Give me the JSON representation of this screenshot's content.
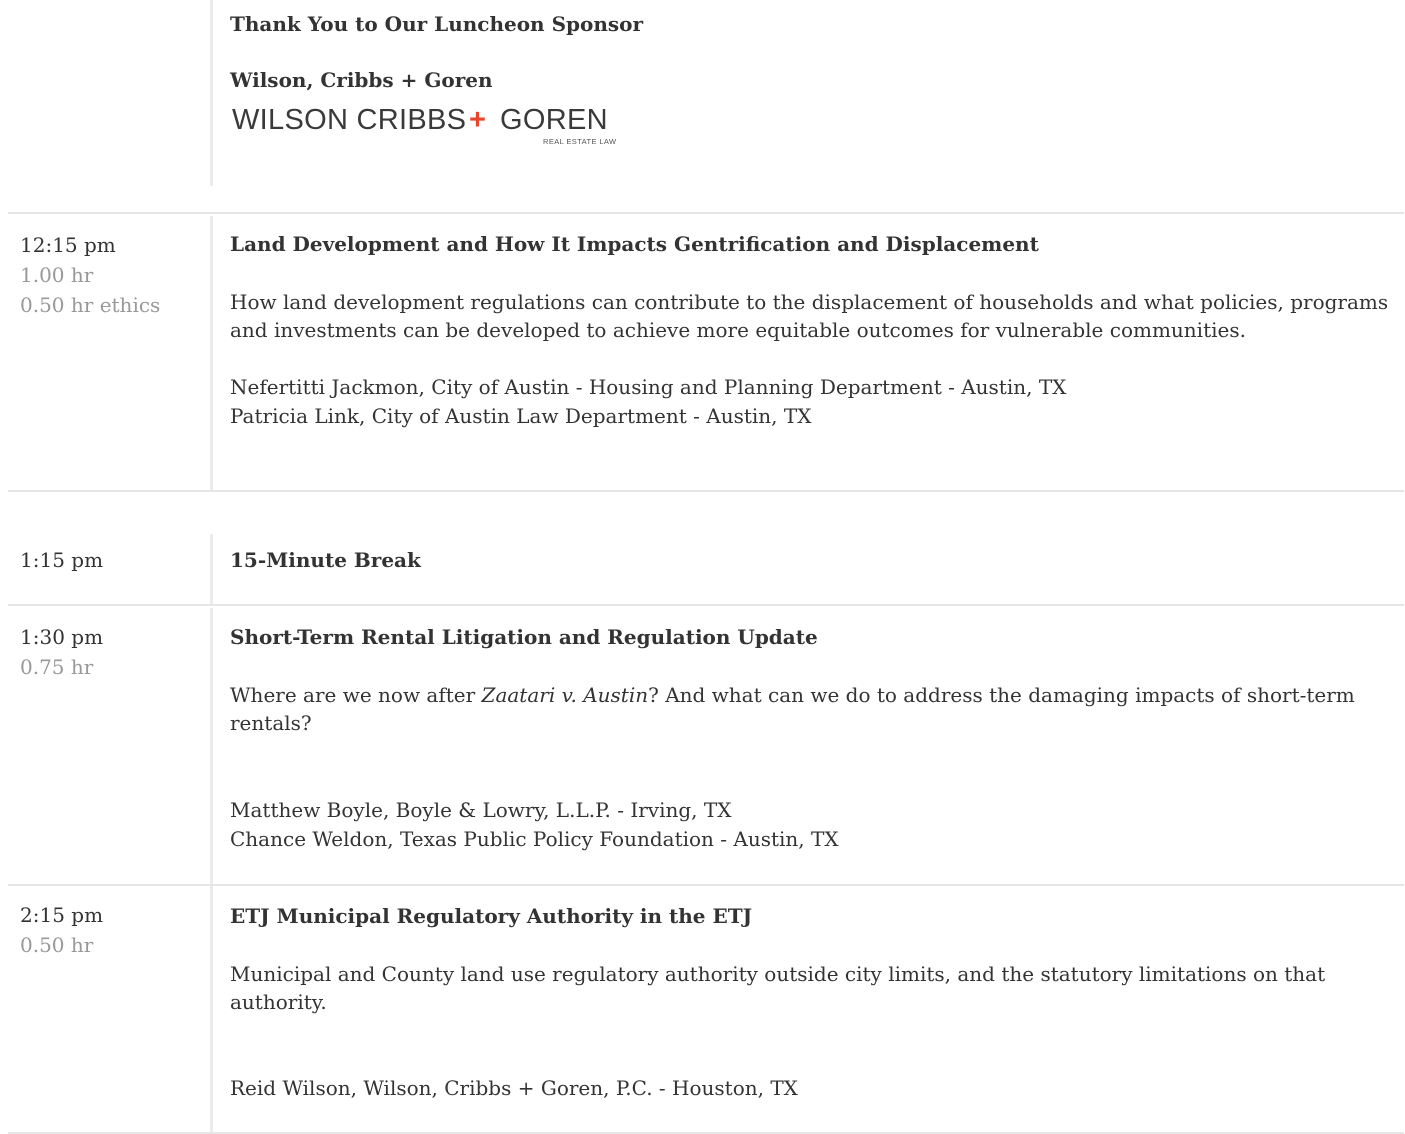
{
  "sponsor": {
    "heading": "Thank You to Our Luncheon Sponsor",
    "name": "Wilson, Cribbs + Goren",
    "logo_text_main": "WILSON CRIBBS",
    "logo_plus": "+",
    "logo_text_end": "GOREN",
    "logo_subtext": "REAL ESTATE LAW",
    "logo_plus_color": "#e8452c"
  },
  "sessions": [
    {
      "time": "12:15 pm",
      "credit": "1.00 hr",
      "ethics": "0.50 hr ethics",
      "title": "Land Development and How It Impacts Gentrification and Displacement",
      "description": "How land development regulations can contribute to the displacement of households and what policies, programs and investments can be developed to achieve more equitable outcomes for vulnerable communities.",
      "speakers": [
        "Nefertitti Jackmon, City of Austin - Housing and Planning Department - Austin, TX",
        "Patricia Link, City of Austin Law Department - Austin, TX"
      ]
    },
    {
      "time": "1:15 pm",
      "title": "15-Minute Break"
    },
    {
      "time": "1:30 pm",
      "credit": "0.75 hr",
      "title": "Short-Term Rental Litigation and Regulation Update",
      "description_pre": "Where are we now after ",
      "description_case": "Zaatari v. Austin",
      "description_post": "? And what can we do to address the damaging impacts of short-term rentals?",
      "speakers": [
        "Matthew Boyle, Boyle & Lowry, L.L.P. - Irving, TX",
        "Chance Weldon, Texas Public Policy Foundation - Austin, TX"
      ]
    },
    {
      "time": "2:15 pm",
      "credit": "0.50 hr",
      "title": "ETJ Municipal Regulatory Authority in the ETJ",
      "description": "Municipal and County land use regulatory authority outside city limits, and the statutory limitations on that authority.",
      "speakers": [
        "Reid Wilson, Wilson, Cribbs + Goren, P.C. - Houston, TX"
      ]
    }
  ]
}
